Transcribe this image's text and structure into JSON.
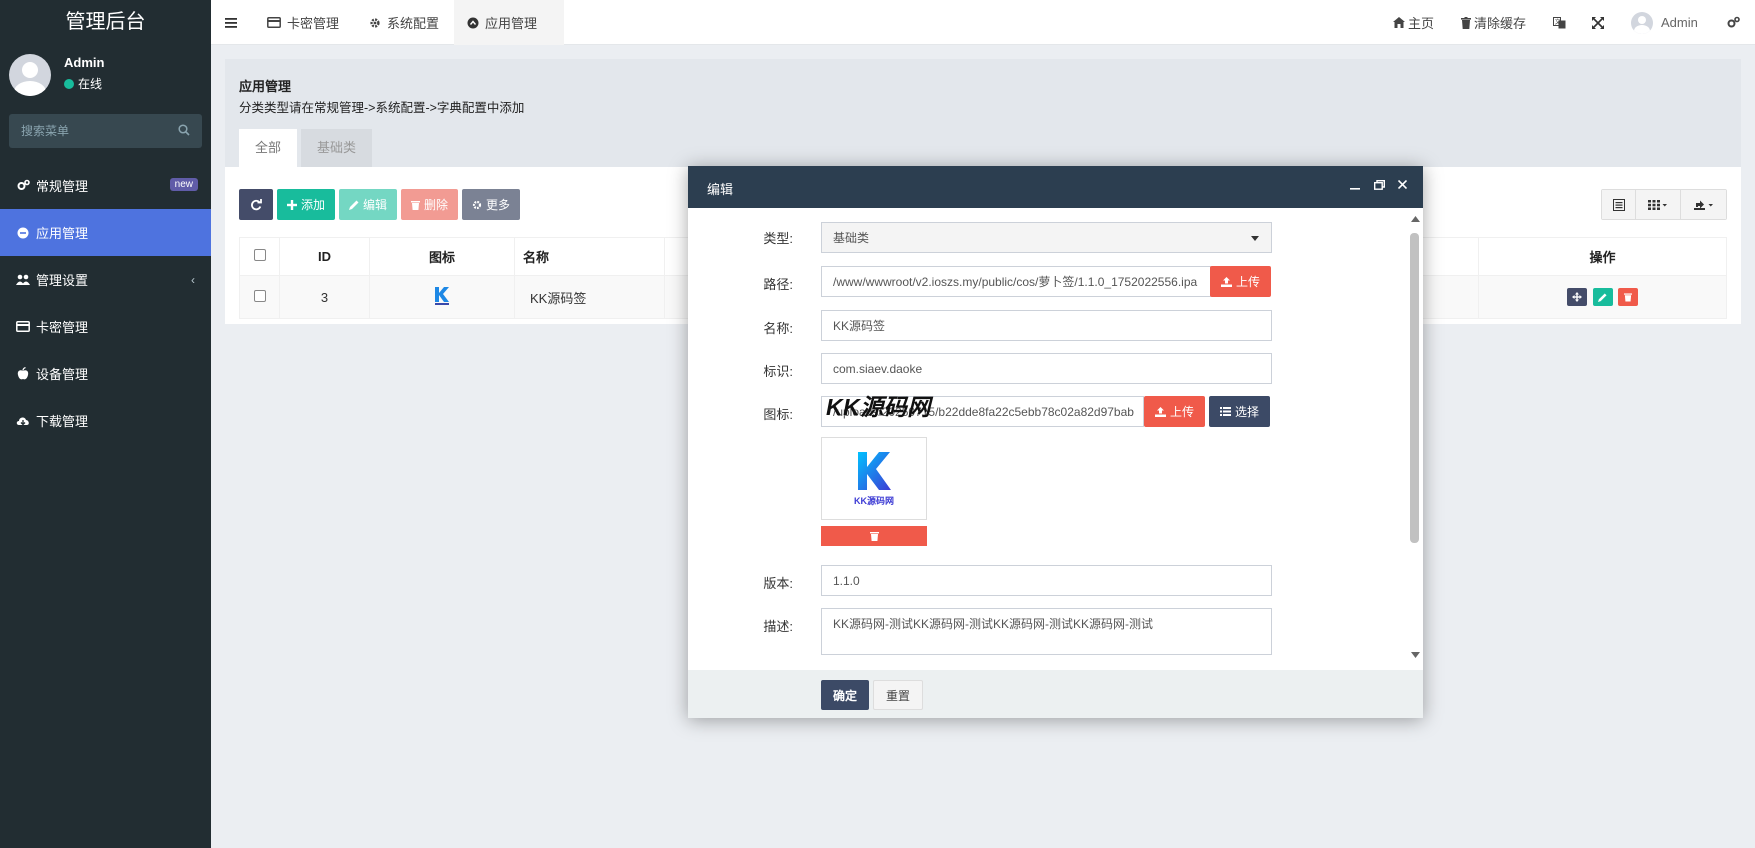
{
  "sidebar": {
    "logo": "管理后台",
    "user": {
      "name": "Admin",
      "status": "在线"
    },
    "search_placeholder": "搜索菜单",
    "items": [
      {
        "label": "常规管理",
        "badge": "new",
        "icon": "cogs-icon"
      },
      {
        "label": "应用管理",
        "icon": "circle-icon",
        "active": true
      },
      {
        "label": "管理设置",
        "icon": "users-icon",
        "chevron": "‹"
      },
      {
        "label": "卡密管理",
        "icon": "credit-card-icon"
      },
      {
        "label": "设备管理",
        "icon": "apple-icon"
      },
      {
        "label": "下载管理",
        "icon": "cloud-download-icon"
      }
    ]
  },
  "topnav": {
    "tabs": [
      {
        "label": "卡密管理",
        "icon": "credit-card-icon"
      },
      {
        "label": "系统配置",
        "icon": "gear-icon"
      },
      {
        "label": "应用管理",
        "icon": "circle-icon",
        "active": true
      }
    ],
    "right": {
      "home": "主页",
      "clear_cache": "清除缓存",
      "user": "Admin"
    }
  },
  "page": {
    "title": "应用管理",
    "subtitle": "分类类型请在常规管理->系统配置->字典配置中添加",
    "tabs": [
      "全部",
      "基础类"
    ],
    "toolbar": {
      "add": "添加",
      "edit": "编辑",
      "delete": "删除",
      "more": "更多"
    },
    "table": {
      "headers": {
        "id": "ID",
        "icon": "图标",
        "name": "名称",
        "ops": "操作"
      },
      "rows": [
        {
          "id": "3",
          "name": "KK源码签"
        }
      ]
    }
  },
  "modal": {
    "title": "编辑",
    "fields": {
      "type_label": "类型:",
      "type_value": "基础类",
      "path_label": "路径:",
      "path_value": "/www/wwwroot/v2.ioszs.my/public/cos/萝卜签/1.1.0_1752022556.ipa",
      "upload": "上传",
      "name_label": "名称:",
      "name_value": "KK源码签",
      "bundle_label": "标识:",
      "bundle_value": "com.siaev.daoke",
      "icon_label": "图标:",
      "icon_value": "/uploads/20250715/b22dde8fa22c5ebb78c02a82d97bab",
      "choose": "选择",
      "version_label": "版本:",
      "version_value": "1.1.0",
      "desc_label": "描述:",
      "desc_value": "KK源码网-测试KK源码网-测试KK源码网-测试KK源码网-测试"
    },
    "thumb_text": "KK源码网",
    "confirm": "确定",
    "reset": "重置"
  },
  "watermark": "KK源码网",
  "colors": {
    "sidebar": "#222d32",
    "accent": "#4e73df",
    "green": "#18bc9c",
    "red": "#f05a4a",
    "navy": "#3c4a66"
  }
}
